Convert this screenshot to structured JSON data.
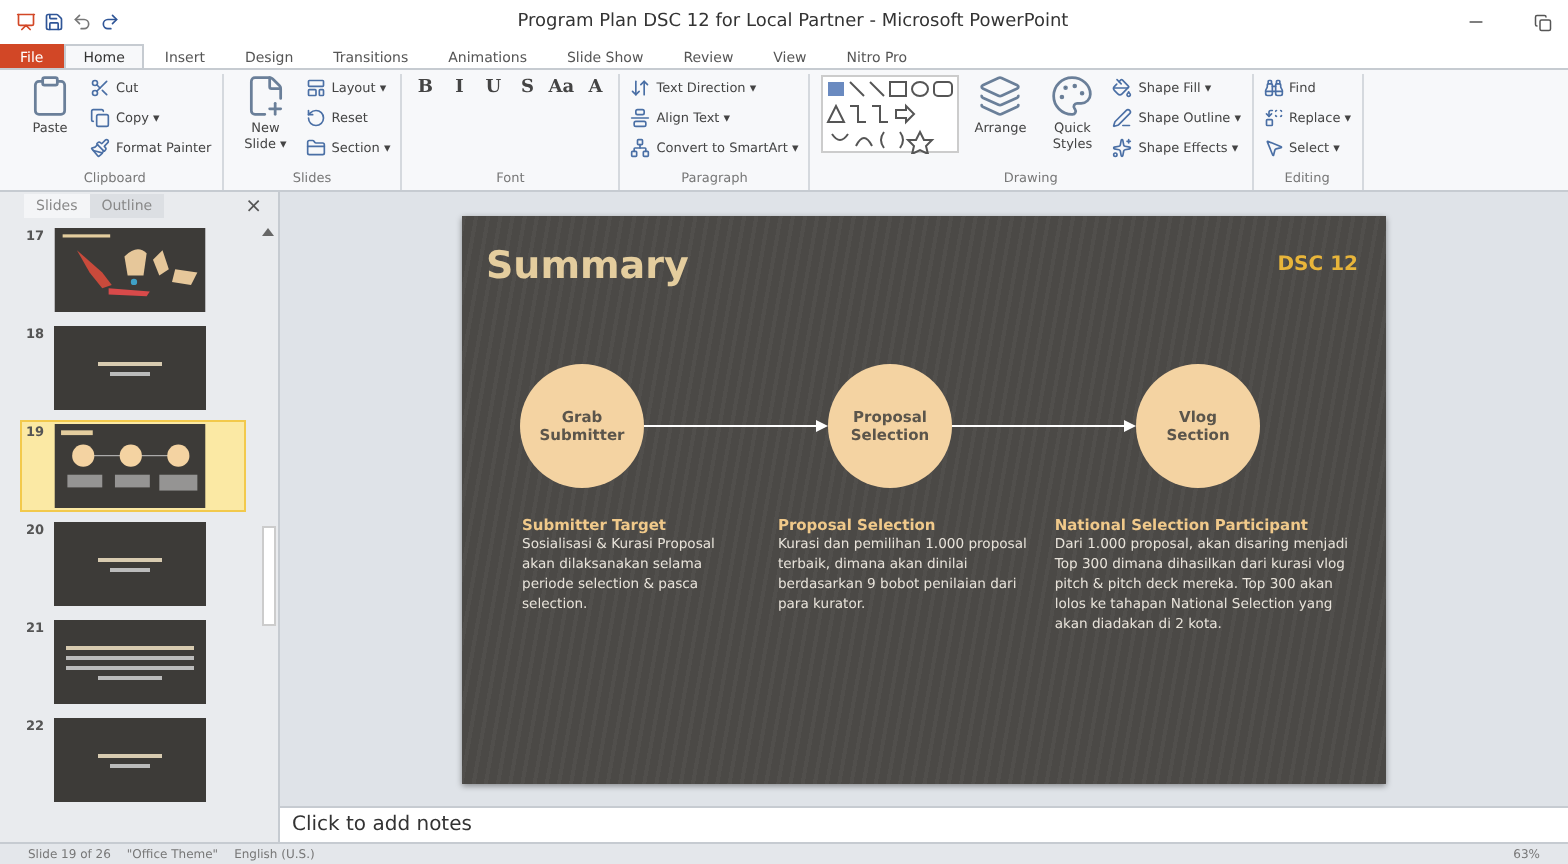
{
  "window": {
    "title": "Program Plan DSC 12 for Local Partner - Microsoft PowerPoint"
  },
  "tabs": [
    {
      "label": "File",
      "kind": "file",
      "selected": false
    },
    {
      "label": "Home",
      "kind": "tab",
      "selected": true
    },
    {
      "label": "Insert",
      "kind": "tab",
      "selected": false
    },
    {
      "label": "Design",
      "kind": "tab",
      "selected": false
    },
    {
      "label": "Transitions",
      "kind": "tab",
      "selected": false
    },
    {
      "label": "Animations",
      "kind": "tab",
      "selected": false
    },
    {
      "label": "Slide Show",
      "kind": "tab",
      "selected": false
    },
    {
      "label": "Review",
      "kind": "tab",
      "selected": false
    },
    {
      "label": "View",
      "kind": "tab",
      "selected": false
    },
    {
      "label": "Nitro Pro",
      "kind": "tab",
      "selected": false
    }
  ],
  "ribbon": {
    "groups": [
      {
        "label": "Clipboard",
        "items": [
          {
            "label": "Paste",
            "kind": "large"
          },
          {
            "label": "Cut",
            "kind": "small"
          },
          {
            "label": "Copy ▾",
            "kind": "small"
          },
          {
            "label": "Format Painter",
            "kind": "small"
          }
        ]
      },
      {
        "label": "Slides",
        "items": [
          {
            "label": "New Slide ▾",
            "kind": "large"
          },
          {
            "label": "Layout ▾",
            "kind": "small"
          },
          {
            "label": "Reset",
            "kind": "small"
          },
          {
            "label": "Section ▾",
            "kind": "small"
          }
        ]
      },
      {
        "label": "Font",
        "items": [
          {
            "label": "B",
            "kind": "glyph"
          },
          {
            "label": "I",
            "kind": "glyph"
          },
          {
            "label": "U",
            "kind": "glyph"
          },
          {
            "label": "S",
            "kind": "glyph"
          },
          {
            "label": "Aa",
            "kind": "glyph"
          },
          {
            "label": "A",
            "kind": "glyph"
          }
        ]
      },
      {
        "label": "Paragraph",
        "items": [
          {
            "label": "Text Direction ▾",
            "kind": "small"
          },
          {
            "label": "Align Text ▾",
            "kind": "small"
          },
          {
            "label": "Convert to SmartArt ▾",
            "kind": "small"
          }
        ]
      },
      {
        "label": "Drawing",
        "items": [
          {
            "kind": "gallery"
          },
          {
            "label": "Arrange",
            "kind": "large"
          },
          {
            "label": "Quick Styles",
            "kind": "large"
          },
          {
            "label": "Shape Fill ▾",
            "kind": "small"
          },
          {
            "label": "Shape Outline ▾",
            "kind": "small"
          },
          {
            "label": "Shape Effects ▾",
            "kind": "small"
          }
        ]
      },
      {
        "label": "Editing",
        "items": [
          {
            "label": "Find",
            "kind": "small"
          },
          {
            "label": "Replace ▾",
            "kind": "small"
          },
          {
            "label": "Select ▾",
            "kind": "small"
          }
        ]
      }
    ]
  },
  "pane": {
    "tabs": [
      {
        "label": "Slides",
        "selected": true
      },
      {
        "label": "Outline",
        "selected": false
      }
    ],
    "close": "×",
    "thumbnails": [
      {
        "number": "17",
        "selected": false
      },
      {
        "number": "18",
        "kind": "title",
        "selected": false
      },
      {
        "number": "19",
        "kind": "summary",
        "selected": true
      },
      {
        "number": "20",
        "kind": "title",
        "selected": false
      },
      {
        "number": "21",
        "kind": "text",
        "selected": false
      },
      {
        "number": "22",
        "kind": "title",
        "selected": false
      }
    ]
  },
  "slide": {
    "title": "Summary",
    "logo": "DSC 12",
    "steps": [
      {
        "label": "Grab Submitter"
      },
      {
        "label": "Proposal Selection"
      },
      {
        "label": "Vlog Section"
      }
    ],
    "descriptions": [
      {
        "heading": "Submitter Target",
        "body": "Sosialisasi & Kurasi Proposal akan dilaksanakan selama periode selection & pasca selection."
      },
      {
        "heading": "Proposal Selection",
        "body": "Kurasi dan pemilihan 1.000 proposal terbaik, dimana akan dinilai berdasarkan 9 bobot penilaian dari para kurator."
      },
      {
        "heading": "National Selection Participant",
        "body": "Dari 1.000 proposal, akan disaring menjadi Top 300 dimana dihasilkan dari kurasi vlog pitch & pitch deck mereka. Top 300 akan lolos ke tahapan National Selection yang akan diadakan di 2 kota."
      }
    ]
  },
  "notes": {
    "placeholder": "Click to add notes"
  },
  "status_bar": [
    "Slide 19 of 26",
    "\"Office Theme\"",
    "English (U.S.)",
    "63%"
  ]
}
